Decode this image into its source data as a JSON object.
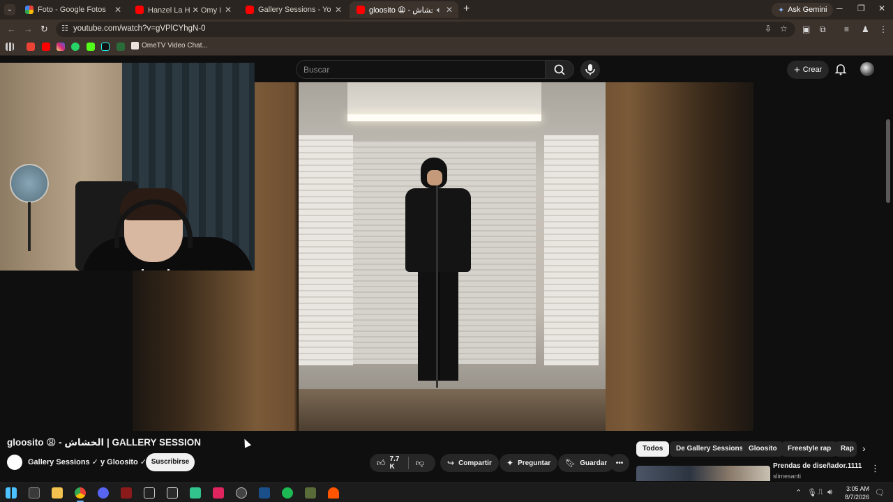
{
  "browser": {
    "tabs": [
      {
        "title": "Foto - Google Fotos",
        "color": "#f4b400",
        "active": false
      },
      {
        "title": "Hanzel La H  ✕ Omy De Oro -",
        "color": "#ff0000",
        "active": false
      },
      {
        "title": "Gallery Sessions - YouTube",
        "color": "#ff0000",
        "active": false
      },
      {
        "title": "gloosito 😩 - الخشاش | G",
        "color": "#ff0000",
        "active": true
      }
    ],
    "ask_gemini": "Ask Gemini",
    "url": "youtube.com/watch?v=gVPlCYhgN-0",
    "bookmark_label": "OmeTV Video Chat..."
  },
  "youtube": {
    "search_placeholder": "Buscar",
    "create_label": "Crear",
    "video_title": "gloosito 😩 - الخشاش | GALLERY SESSION",
    "channel": "Gallery Sessions ✓ y Gloosito ✓",
    "subscribe_label": "Suscribirse",
    "likes": "7.7 K",
    "share_label": "Compartir",
    "ask_label": "Preguntar",
    "save_label": "Guardar",
    "chips": [
      "Todos",
      "De Gallery Sessions",
      "Gloosito",
      "Freestyle rap",
      "Rap"
    ],
    "recommendation": {
      "title": "Prendas de diseñador.1111",
      "channel": "slimesanti"
    }
  },
  "taskbar": {
    "time": "3:05 AM",
    "date": "8/7/2026"
  }
}
